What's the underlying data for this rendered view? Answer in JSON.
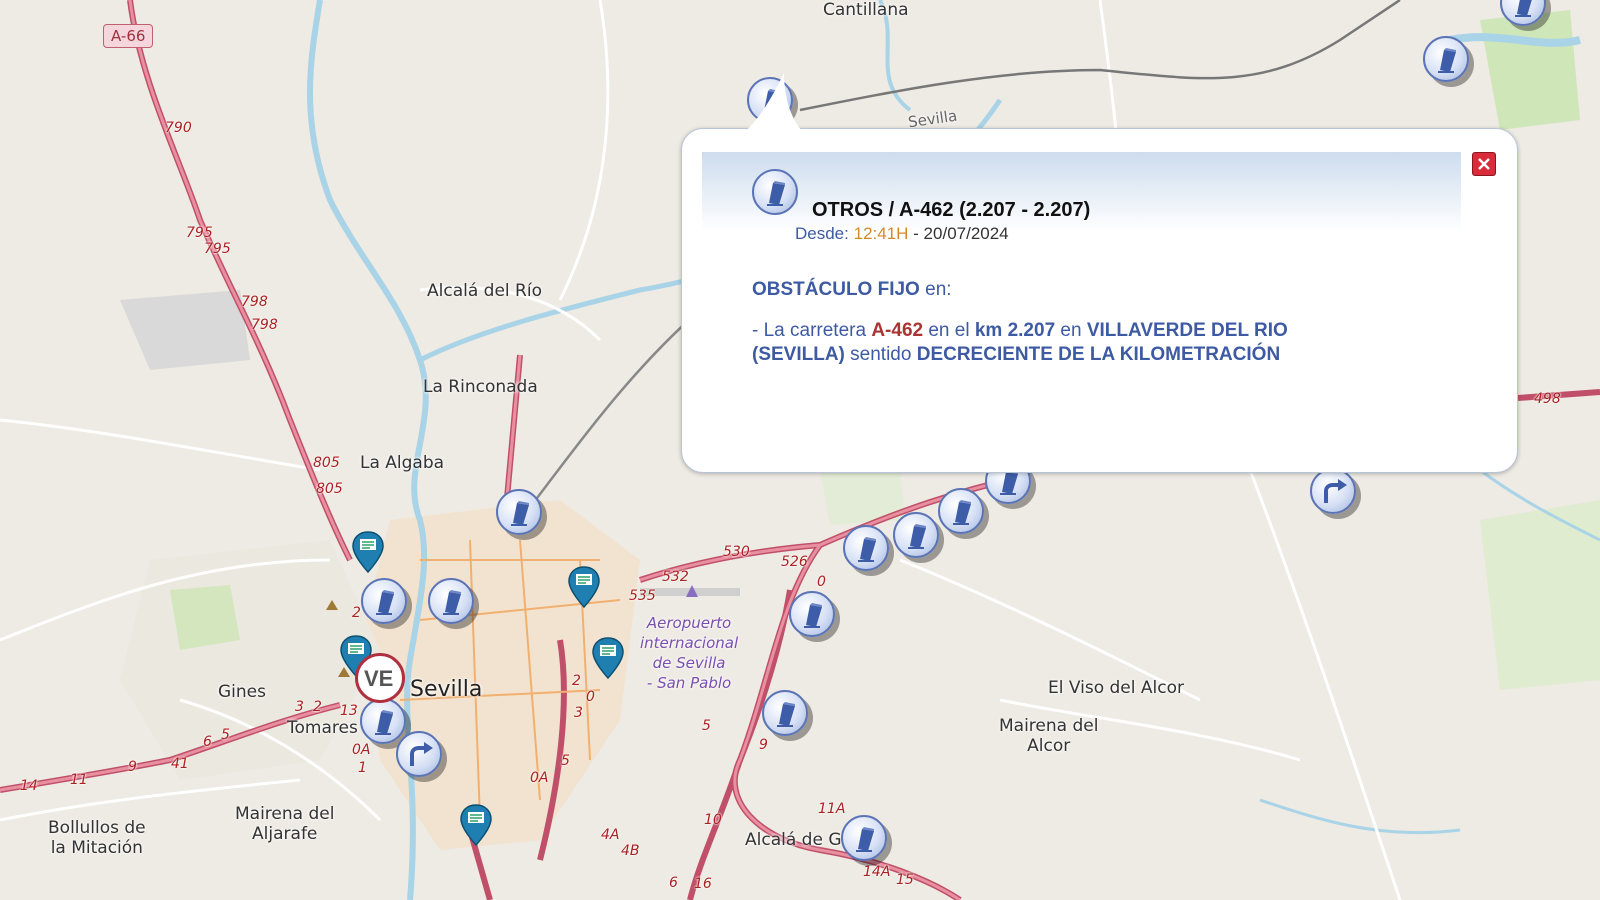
{
  "map": {
    "route_shields": [
      "A-66"
    ],
    "places": {
      "cantillana": "Cantillana",
      "alcala_rio": "Alcalá del Río",
      "la_rinconada": "La Rinconada",
      "la_algaba": "La Algaba",
      "sevilla": "Sevilla",
      "gines": "Gines",
      "tomares": "Tomares",
      "bollullos": "Bollullos de\nla Mitación",
      "mairena_aljarafe": "Mairena del\nAljarafe",
      "alcala_guadaira": "Alcalá de Gu",
      "el_viso": "El Viso del Alcor",
      "mairena_alcor": "Mairena del\nAlcor",
      "airport": "Aeropuerto\ninternacional\nde Sevilla\n- San Pablo",
      "sevilla_partial": "Sevilla"
    },
    "km_labels": [
      "790",
      "795",
      "795",
      "798",
      "798",
      "805",
      "805",
      "530",
      "526",
      "532",
      "535",
      "498",
      "10",
      "11A",
      "14A",
      "15",
      "4A",
      "4B",
      "6",
      "16",
      "0A",
      "9",
      "5",
      "2",
      "0",
      "3",
      "13",
      "11",
      "9",
      "41",
      "6",
      "5",
      "3",
      "2",
      "1",
      "2",
      "0",
      "0A",
      "5",
      "14"
    ],
    "marker_labels": {
      "ve": "VE"
    }
  },
  "popup": {
    "title": "OTROS / A-462 (2.207 - 2.207)",
    "since_label": "Desde:",
    "since_time": "12:41H",
    "since_date": "- 20/07/2024",
    "heading_bold": "OBSTÁCULO FIJO",
    "heading_rest": " en:",
    "body": {
      "p1": "- La carretera ",
      "road": "A-462",
      "p2": " en el ",
      "km": "km 2.207",
      "p3": " en ",
      "place": "VILLAVERDE DEL RIO (SEVILLA)",
      "p4": " sentido ",
      "direction": "DECRECIENTE DE LA KILOMETRACIÓN"
    }
  },
  "colors": {
    "motorway": "#e890a0",
    "motorway_casing": "#c0506a",
    "water": "#a9d3e6",
    "urban": "#e0ddd8",
    "green": "#d8e8c0",
    "marker_border": "#5b74b5",
    "close": "#d92b3a"
  }
}
